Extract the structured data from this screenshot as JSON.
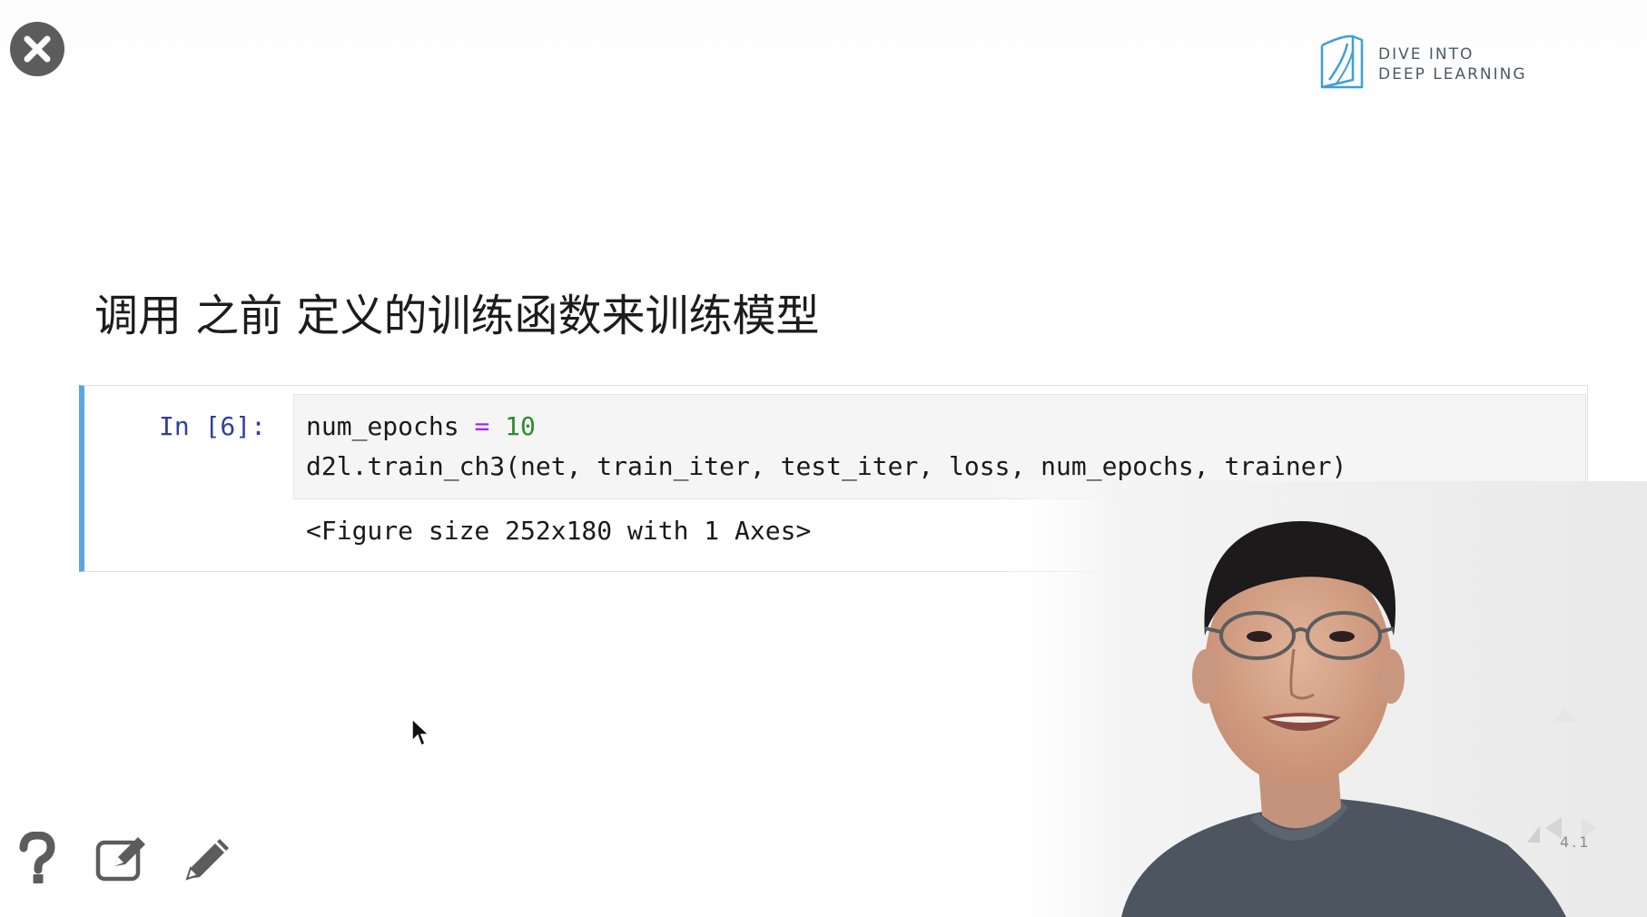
{
  "logo": {
    "line1": "DIVE INTO",
    "line2": "DEEP LEARNING"
  },
  "slide": {
    "title": "调用 之前 定义的训练函数来训练模型",
    "number": "4.1"
  },
  "cell": {
    "prompt": "In [6]:",
    "code_line1": {
      "var": "num_epochs",
      "op": "=",
      "num": "10"
    },
    "code_line2": "d2l.train_ch3(net, train_iter, test_iter, loss, num_epochs, trainer)",
    "output": "<Figure size 252x180 with 1 Axes>"
  },
  "toolbar": {
    "help_icon": "question-mark-icon",
    "notes_icon": "edit-note-icon",
    "pen_icon": "pencil-icon"
  },
  "colors": {
    "cell_accent": "#5ba4e6",
    "prompt": "#303f9f",
    "keyword_op": "#aa22ff",
    "number": "#2e8b2e",
    "logo": "#3d9fd9"
  }
}
